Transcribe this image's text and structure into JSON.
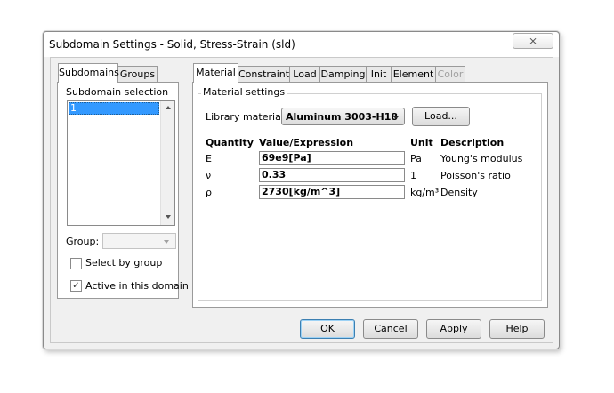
{
  "window": {
    "title": "Subdomain Settings - Solid, Stress-Strain (sld)",
    "close_glyph": "⨯"
  },
  "left_tabs": [
    "Subdomains",
    "Groups"
  ],
  "subdomain": {
    "selection_label": "Subdomain selection",
    "items": [
      "1"
    ],
    "group_label": "Group:",
    "select_by_group": "Select by group",
    "active_in_domain": "Active in this domain",
    "active_checked_glyph": "✓"
  },
  "right_tabs": [
    "Material",
    "Constraint",
    "Load",
    "Damping",
    "Init",
    "Element",
    "Color"
  ],
  "material": {
    "group_title": "Material settings",
    "library_label": "Library material:",
    "library_value": "Aluminum 3003-H18",
    "load_button": "Load...",
    "headers": {
      "quantity": "Quantity",
      "value": "Value/Expression",
      "unit": "Unit",
      "description": "Description"
    },
    "rows": [
      {
        "quantity": "E",
        "value": "69e9[Pa]",
        "unit": "Pa",
        "description": "Young's modulus"
      },
      {
        "quantity": "ν",
        "value": "0.33",
        "unit": "1",
        "description": "Poisson's ratio"
      },
      {
        "quantity": "ρ",
        "value": "2730[kg/m^3]",
        "unit": "kg/m³",
        "description": "Density"
      }
    ]
  },
  "footer": {
    "ok": "OK",
    "cancel": "Cancel",
    "apply": "Apply",
    "help": "Help"
  },
  "colors": {
    "selection": "#3399ff",
    "disabled_text": "#a0a0a0"
  }
}
